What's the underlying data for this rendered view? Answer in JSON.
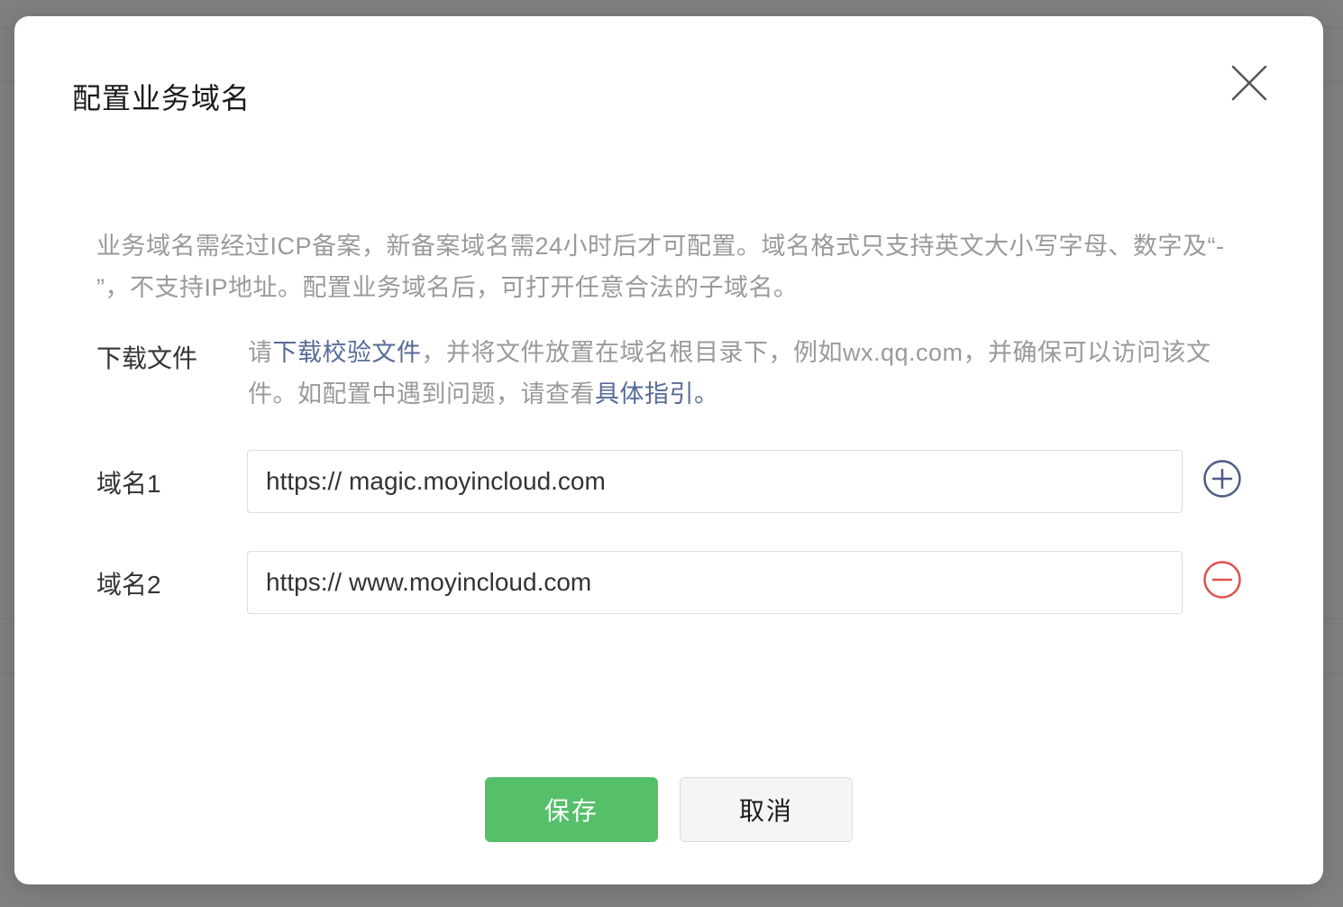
{
  "modal": {
    "title": "配置业务域名",
    "description": "业务域名需经过ICP备案，新备案域名需24小时后才可配置。域名格式只支持英文大小写字母、数字及“- ”，不支持IP地址。配置业务域名后，可打开任意合法的子域名。",
    "download": {
      "label": "下载文件",
      "text_before": "请",
      "link_download": "下载校验文件",
      "text_middle": "，并将文件放置在域名根目录下，例如wx.qq.com，并确保可以访问该文件。如配置中遇到问题，请查看",
      "link_guide": "具体指引",
      "text_after": "。"
    },
    "domains": [
      {
        "label": "域名1",
        "prefix": "https://",
        "value": "magic.moyincloud.com",
        "action": "plus-circle-icon"
      },
      {
        "label": "域名2",
        "prefix": "https://",
        "value": "www.moyincloud.com",
        "action": "minus-circle-icon"
      }
    ],
    "buttons": {
      "save": "保存",
      "cancel": "取消"
    }
  },
  "colors": {
    "primary_green": "#55bf6a",
    "link_blue": "#576b95",
    "add_icon": "#4e5b85",
    "remove_icon": "#e0514f"
  }
}
